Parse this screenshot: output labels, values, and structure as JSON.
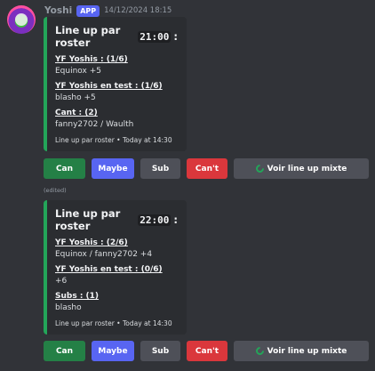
{
  "message": {
    "username": "Yoshi",
    "app_badge": "APP",
    "timestamp": "14/12/2024 18:15",
    "edited_label": "(edited)"
  },
  "embeds": [
    {
      "title_prefix": "Line up par roster",
      "title_time": "21:00",
      "title_suffix": ":",
      "fields": [
        {
          "name": "YF Yoshis : (1/6)",
          "value": "Equinox +5"
        },
        {
          "name": "YF Yoshis en test : (1/6)",
          "value": "blasho +5"
        },
        {
          "name": "Cant : (2)",
          "value": "fanny2702 / Waulth"
        }
      ],
      "footer": "Line up par roster • Today at 14:30"
    },
    {
      "title_prefix": "Line up par roster",
      "title_time": "22:00",
      "title_suffix": ":",
      "fields": [
        {
          "name": "YF Yoshis : (2/6)",
          "value": "Equinox / fanny2702 +4"
        },
        {
          "name": "YF Yoshis en test : (0/6)",
          "value": "+6"
        },
        {
          "name": "Subs : (1)",
          "value": "blasho"
        }
      ],
      "footer": "Line up par roster • Today at 14:30"
    }
  ],
  "buttons": {
    "can": "Can",
    "maybe": "Maybe",
    "sub": "Sub",
    "cant": "Can't",
    "mixte": "Voir line up mixte"
  },
  "colors": {
    "accent_green": "#23a559",
    "blurple": "#5865f2",
    "danger": "#da373c",
    "secondary": "#4e5058"
  },
  "icons": {
    "mixte": "loading-ring-icon"
  }
}
